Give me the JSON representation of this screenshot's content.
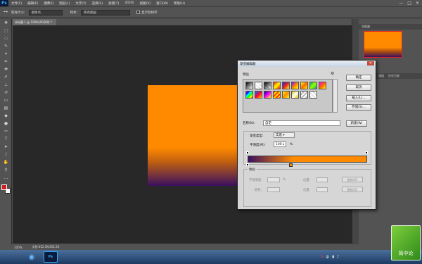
{
  "app": {
    "logo": "Ps"
  },
  "menubar": {
    "items": [
      "文件(F)",
      "编辑(E)",
      "图像(I)",
      "图层(L)",
      "文字(Y)",
      "选择(S)",
      "滤镜(T)",
      "3D(D)",
      "视图(V)",
      "窗口(W)",
      "帮助(H)"
    ],
    "window_controls": [
      "—",
      "□",
      "✕"
    ]
  },
  "optionsbar": {
    "tool_icon": "eyedropper-icon",
    "sample_size_label": "取样大小:",
    "sample_size_value": "取样点",
    "sample_label": "样本:",
    "sample_value": "所有图层",
    "show_ring_label": "显示取样环"
  },
  "document": {
    "tab_title": "未标题-1 @ 100%(RGB/8) *",
    "gradient_colors": [
      "#ff8a00",
      "#3a0f60"
    ]
  },
  "statusbar": {
    "zoom": "100%",
    "doc_size": "文档:452.2K/452.2K"
  },
  "panels": {
    "navigator_tab": "导航器",
    "layers_tabs": [
      "通道",
      "历史记录"
    ]
  },
  "dialog": {
    "title": "渐变编辑器",
    "presets_label": "预设",
    "buttons": {
      "ok": "确定",
      "cancel": "取消",
      "load": "载入(L)...",
      "save": "存储(S)...",
      "new": "新建(W)"
    },
    "name_label": "名称(N):",
    "name_value": "自定",
    "grad_type_label": "渐变类型:",
    "grad_type_value": "实底",
    "smoothness_label": "平滑度(M):",
    "smoothness_value": "100",
    "smoothness_unit": "%",
    "stops_label": "色标",
    "opacity_label": "不透明度:",
    "opacity_unit": "%",
    "location_label": "位置:",
    "delete_label": "删除(D)",
    "color_label": "颜色:",
    "gradient_start": "#3a0f60",
    "gradient_end": "#ff8a00"
  },
  "taskbar": {
    "clock_time": "9:05",
    "clock_date": "2017/5/4"
  },
  "watermark": {
    "text": "简中论"
  }
}
